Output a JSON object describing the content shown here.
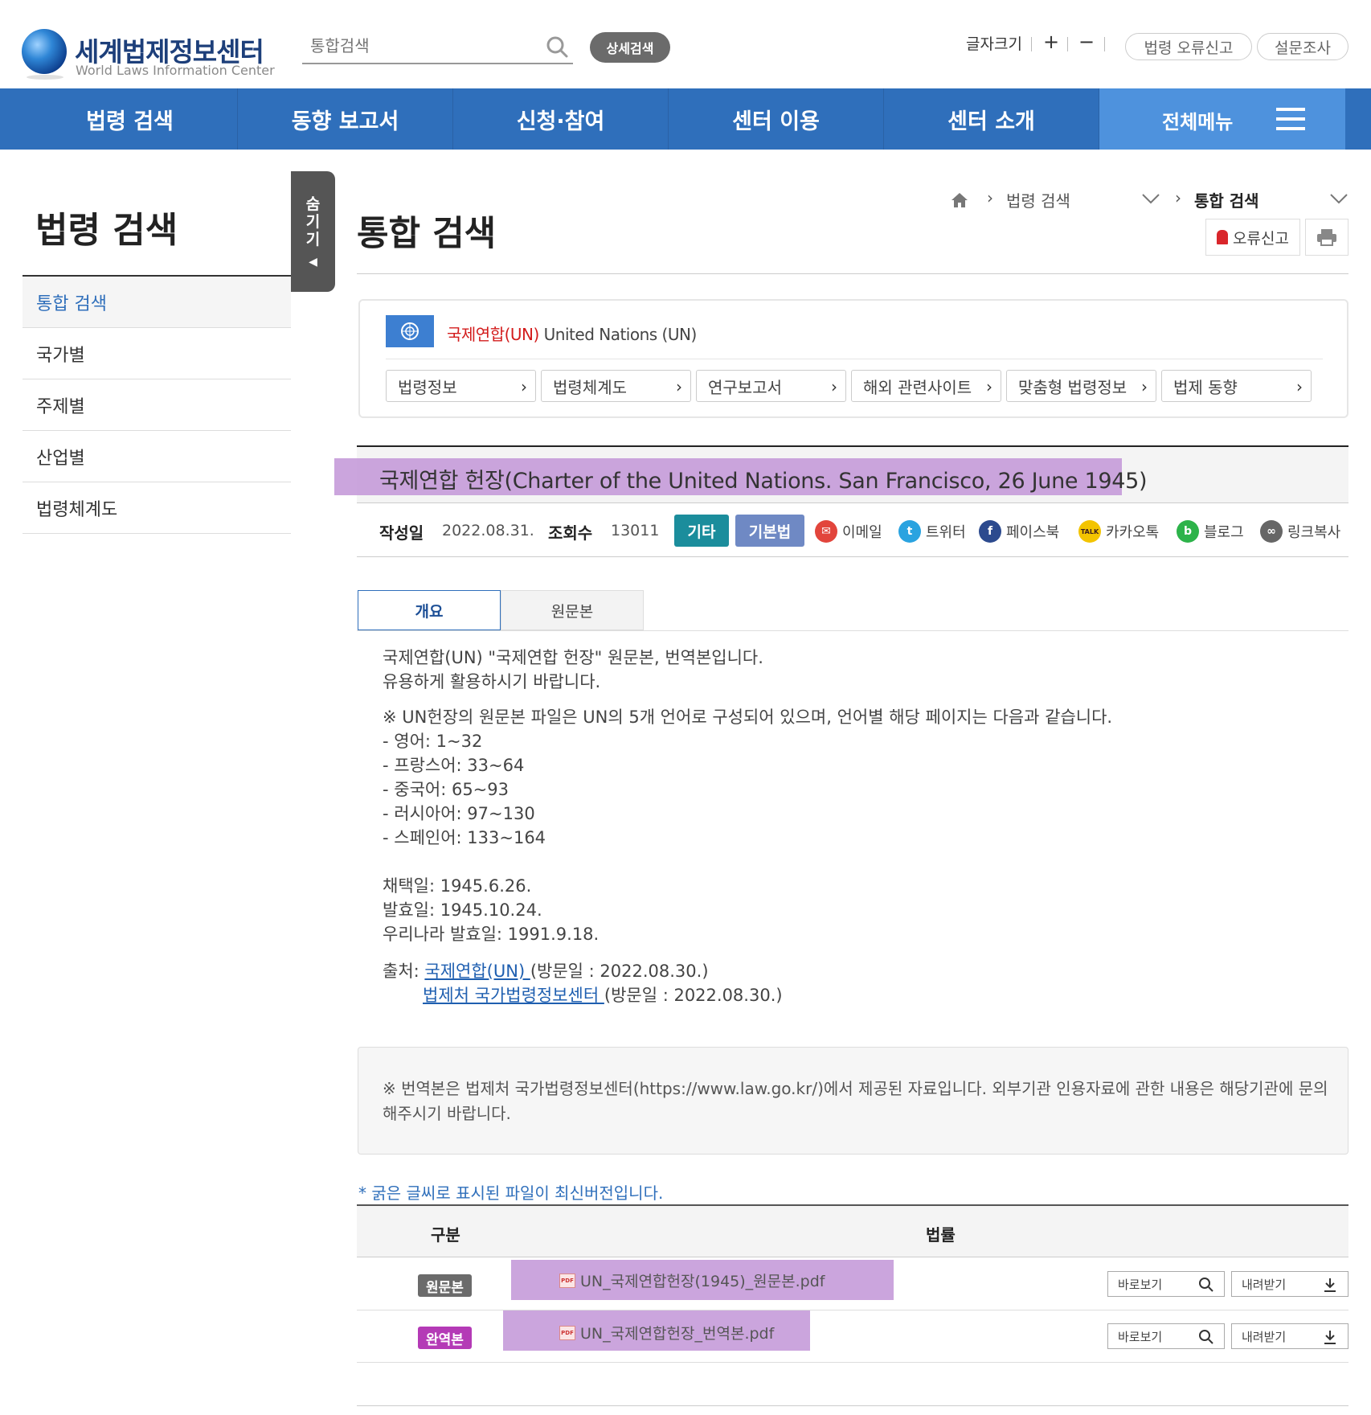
{
  "header": {
    "logo_ko": "세계법제정보센터",
    "logo_en": "World Laws Information Center",
    "search_placeholder": "통합검색",
    "detail_search": "상세검색",
    "font_size_label": "글자크기",
    "font_plus": "+",
    "font_minus": "−",
    "error_report": "법령 오류신고",
    "survey": "설문조사"
  },
  "gnb": {
    "items": [
      "법령 검색",
      "동향 보고서",
      "신청·참여",
      "센터 이용",
      "센터 소개"
    ],
    "all_menu": "전체메뉴"
  },
  "sidebar": {
    "title": "법령 검색",
    "hide_tab": [
      "숨",
      "기",
      "기"
    ],
    "hide_arrow": "◀",
    "items": [
      "통합 검색",
      "국가별",
      "주제별",
      "산업별",
      "법령체계도"
    ]
  },
  "content": {
    "page_title": "통합 검색",
    "breadcrumb": [
      "법령 검색",
      "통합 검색"
    ],
    "error_btn": "오류신고",
    "org": {
      "name_ko": "국제연합(UN)",
      "name_en": "United Nations (UN)",
      "links": [
        "법령정보",
        "법령체계도",
        "연구보고서",
        "해외 관련사이트",
        "맞춤형 법령정보",
        "법제 동향"
      ]
    },
    "doc": {
      "title": "국제연합 헌장(Charter of the United Nations. San Francisco, 26 June 1945)",
      "date_label": "작성일",
      "date_value": "2022.08.31.",
      "views_label": "조회수",
      "views_value": "13011",
      "tags": [
        "기타",
        "기본법"
      ],
      "share": [
        "이메일",
        "트위터",
        "페이스북",
        "카카오톡",
        "블로그",
        "링크복사"
      ]
    },
    "tabs": [
      "개요",
      "원문본"
    ],
    "body": {
      "intro1": "국제연합(UN) \"국제연합 헌장\" 원문본, 번역본입니다.",
      "intro2": "유용하게 활용하시기 바랍니다.",
      "note": "※ UN헌장의 원문본 파일은 UN의 5개 언어로 구성되어 있으며, 언어별 해당 페이지는 다음과 같습니다.",
      "languages": [
        "- 영어: 1~32",
        "- 프랑스어: 33~64",
        "- 중국어: 65~93",
        "- 러시아어: 97~130",
        "- 스페인어: 133~164"
      ],
      "adopted": "채택일: 1945.6.26.",
      "effective": "발효일: 1945.10.24.",
      "korea_effective": "우리나라 발효일: 1991.9.18.",
      "source_label": "출처:",
      "source1_link": "국제연합(UN) ",
      "source1_visit": "(방문일 : 2022.08.30.)",
      "source2_link": "법제처 국가법령정보센터 ",
      "source2_visit": "(방문일 : 2022.08.30.)"
    },
    "notice": "※ 번역본은 법제처 국가법령정보센터(https://www.law.go.kr/)에서 제공된 자료입니다. 외부기관 인용자료에 관한 내용은 해당기관에 문의해주시기 바랍니다.",
    "latest_note": "* 굵은 글씨로 표시된 파일이 최신버전입니다.",
    "table": {
      "headers": [
        "구분",
        "법률"
      ],
      "rows": [
        {
          "badge": "원문본",
          "badge_color": "#6b6b6b",
          "file": "UN_국제연합헌장(1945)_원문본.pdf"
        },
        {
          "badge": "완역본",
          "badge_color": "#b43ab6",
          "file": "UN_국제연합헌장_번역본.pdf"
        }
      ],
      "view_btn": "바로보기",
      "download_btn": "내려받기"
    }
  }
}
